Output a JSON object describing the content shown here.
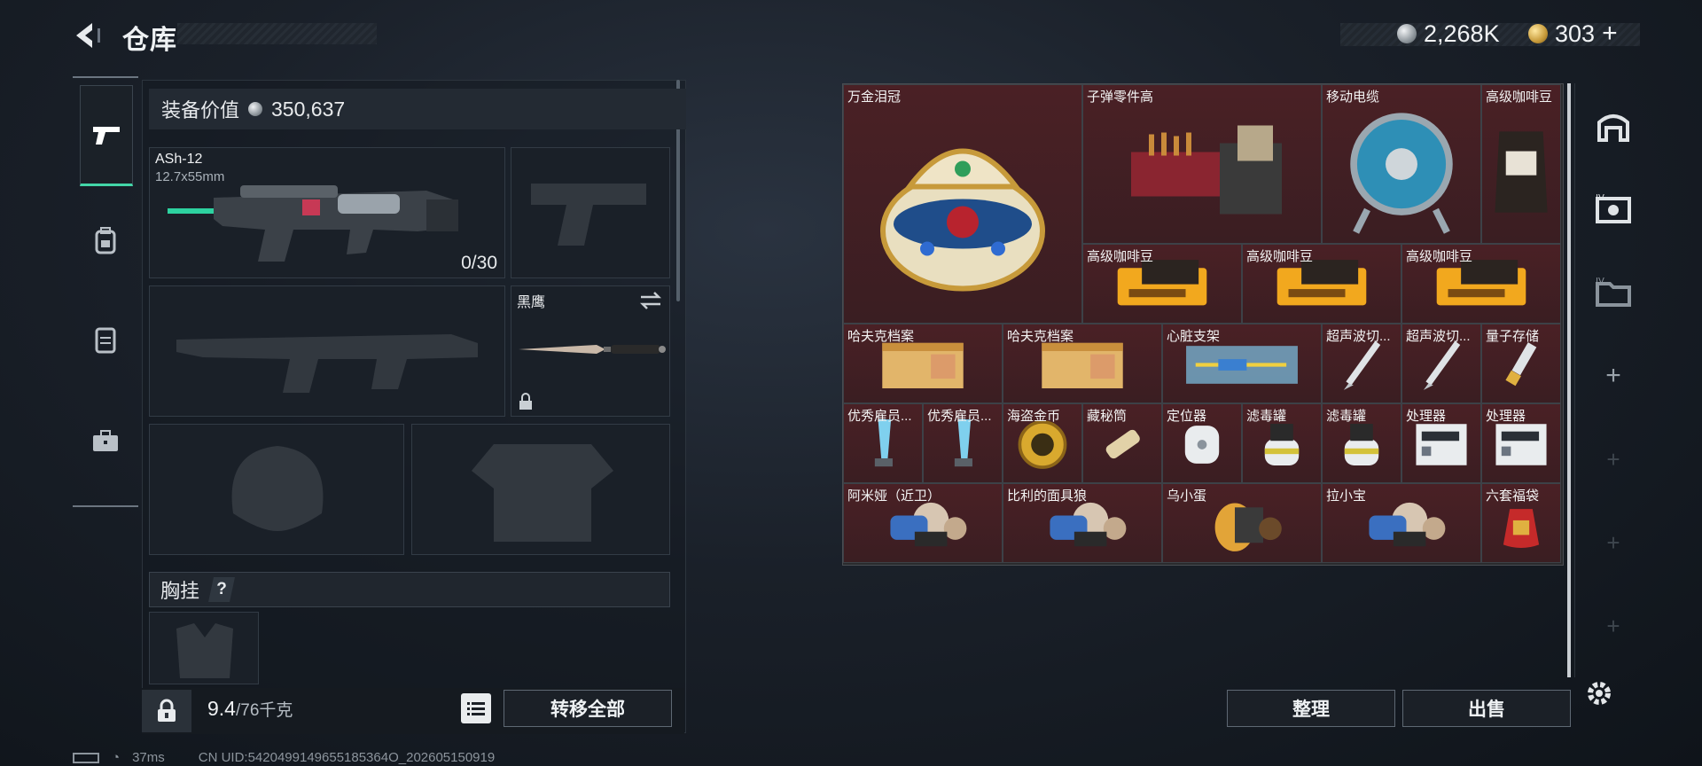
{
  "header": {
    "title": "仓库",
    "silver_amount": "2,268K",
    "gold_amount": "303"
  },
  "equipment": {
    "value_label": "装备价值",
    "value": "350,637",
    "primary_weapon": {
      "name": "ASh-12",
      "caliber": "12.7x55mm",
      "ammo": "0/30"
    },
    "melee": {
      "name": "黑鹰"
    },
    "chest_rig_label": "胸挂",
    "help_mark": "?"
  },
  "footer": {
    "weight": "9.4",
    "weight_max": "/76千克",
    "transfer_all": "转移全部"
  },
  "status": {
    "ping": "37ms",
    "uid": "CN UID:5420499149655185364O_202605150919"
  },
  "storage": {
    "items": [
      {
        "name": "万金泪冠",
        "art": "crown",
        "tone": "gold"
      },
      {
        "name": "子弹零件高",
        "art": "parts",
        "tone": "gold"
      },
      {
        "name": "移动电缆",
        "art": "cable",
        "tone": "gold"
      },
      {
        "name": "高级咖啡豆",
        "art": "coffee-bag",
        "tone": "gold"
      },
      {
        "name": "高级咖啡豆",
        "art": "coffee-box",
        "tone": "gold"
      },
      {
        "name": "高级咖啡豆",
        "art": "coffee-box",
        "tone": "gold"
      },
      {
        "name": "高级咖啡豆",
        "art": "coffee-box",
        "tone": "gold"
      },
      {
        "name": "哈夫克档案",
        "art": "folder",
        "tone": "gold"
      },
      {
        "name": "哈夫克档案",
        "art": "folder",
        "tone": "gold"
      },
      {
        "name": "心脏支架",
        "art": "stent",
        "tone": "gold"
      },
      {
        "name": "超声波切...",
        "art": "scalpel",
        "tone": "gold"
      },
      {
        "name": "超声波切...",
        "art": "scalpel",
        "tone": "gold"
      },
      {
        "name": "量子存储",
        "art": "usb",
        "tone": "gold"
      },
      {
        "name": "优秀雇员...",
        "art": "trophy",
        "tone": "gold"
      },
      {
        "name": "优秀雇员...",
        "art": "trophy",
        "tone": "gold"
      },
      {
        "name": "海盗金币",
        "art": "coin",
        "tone": "gold"
      },
      {
        "name": "藏秘筒",
        "art": "cylinder",
        "tone": "gold"
      },
      {
        "name": "定位器",
        "art": "locator",
        "tone": "gold"
      },
      {
        "name": "滤毒罐",
        "art": "canister",
        "tone": "gold"
      },
      {
        "name": "滤毒罐",
        "art": "canister",
        "tone": "gold"
      },
      {
        "name": "处理器",
        "art": "processor",
        "tone": "gold"
      },
      {
        "name": "处理器",
        "art": "processor",
        "tone": "gold"
      },
      {
        "name": "阿米娅（近卫）",
        "art": "figure",
        "tone": "gold"
      },
      {
        "name": "比利的面具狼",
        "art": "figure",
        "tone": "gold"
      },
      {
        "name": "乌小蛋",
        "art": "egg",
        "tone": "gold"
      },
      {
        "name": "拉小宝",
        "art": "figure",
        "tone": "gold"
      },
      {
        "name": "六套福袋",
        "art": "lucky-bag",
        "tone": "gold"
      }
    ]
  },
  "actions": {
    "sort": "整理",
    "sell": "出售"
  },
  "colors": {
    "accent": "#43d6a8",
    "rare_cell": "#3e2226"
  }
}
